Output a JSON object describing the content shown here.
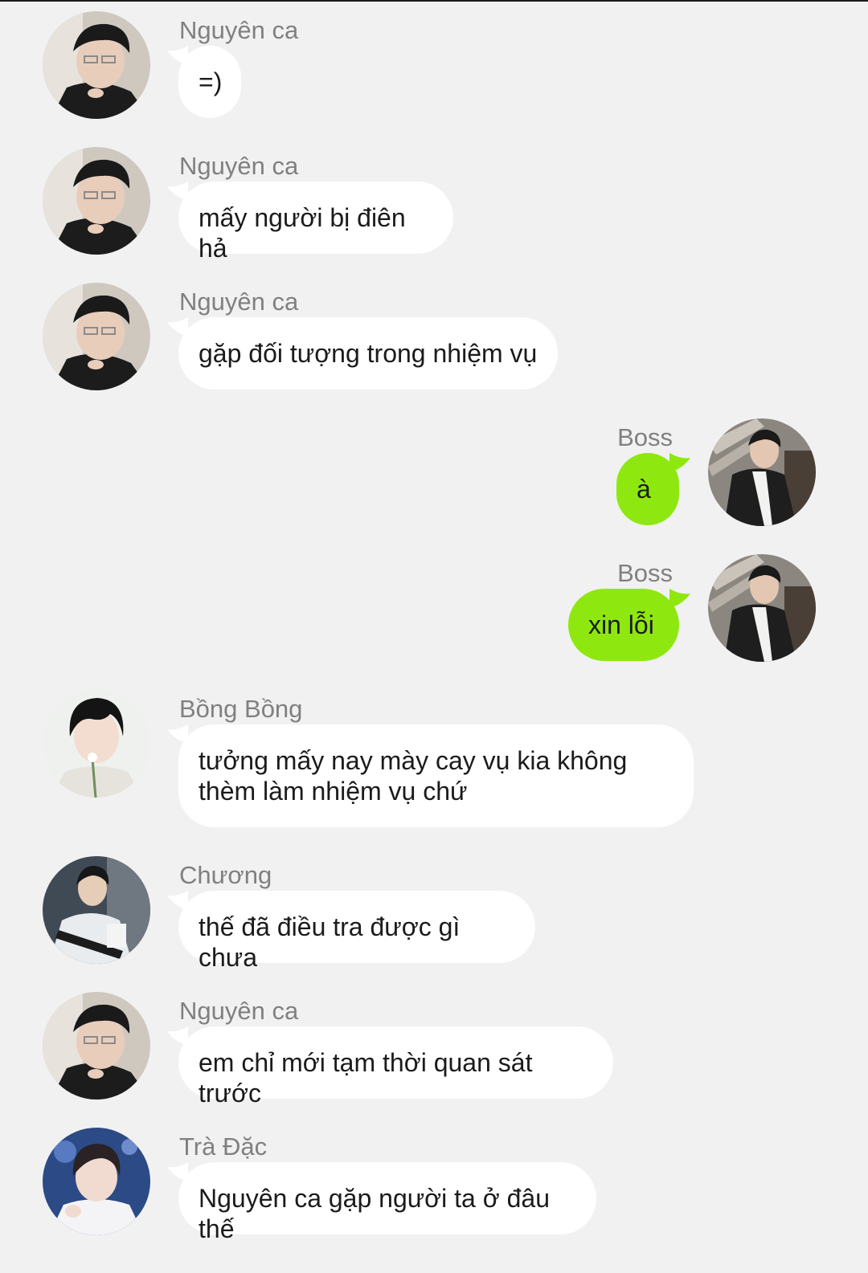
{
  "theme": {
    "background": "#f1f1f1",
    "incoming_bubble": "#ffffff",
    "outgoing_bubble": "#8ee80f",
    "sender_text": "#808080",
    "message_text": "#1b1b1b"
  },
  "messages": [
    {
      "side": "left",
      "sender": "Nguyên ca",
      "avatar": "nguyen-ca-avatar",
      "text": "=)"
    },
    {
      "side": "left",
      "sender": "Nguyên ca",
      "avatar": "nguyen-ca-avatar",
      "text": "mấy người bị điên hả"
    },
    {
      "side": "left",
      "sender": "Nguyên ca",
      "avatar": "nguyen-ca-avatar",
      "text": "gặp đối tượng trong nhiệm vụ"
    },
    {
      "side": "right",
      "sender": "Boss",
      "avatar": "boss-avatar",
      "text": "à"
    },
    {
      "side": "right",
      "sender": "Boss",
      "avatar": "boss-avatar",
      "text": "xin lỗi"
    },
    {
      "side": "left",
      "sender": "Bồng Bồng",
      "avatar": "bong-bong-avatar",
      "text": "tưởng mấy nay mày cay vụ kia không thèm làm nhiệm vụ chứ"
    },
    {
      "side": "left",
      "sender": "Chương",
      "avatar": "chuong-avatar",
      "text": "thế đã điều tra được gì chưa"
    },
    {
      "side": "left",
      "sender": "Nguyên ca",
      "avatar": "nguyen-ca-avatar",
      "text": "em chỉ mới tạm thời quan sát trước"
    },
    {
      "side": "left",
      "sender": "Trà Đặc",
      "avatar": "tra-dac-avatar",
      "text": "Nguyên ca gặp người ta ở đâu thế"
    }
  ]
}
